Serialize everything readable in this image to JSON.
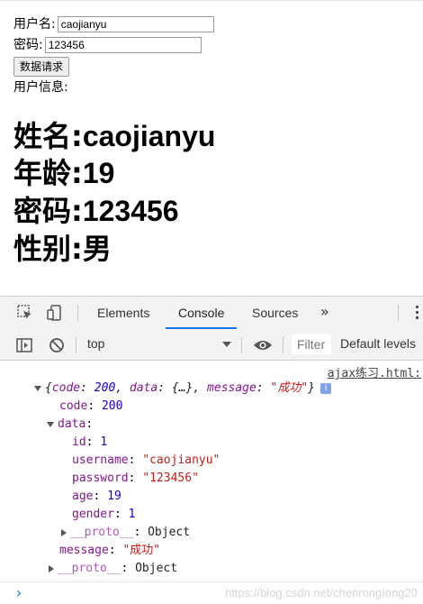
{
  "form": {
    "username_label": "用户名:",
    "username_value": "caojianyu",
    "password_label": "密码:",
    "password_value": "123456",
    "request_button": "数据请求",
    "info_label": "用户信息:"
  },
  "user_info": [
    {
      "label": "姓名:",
      "value": "caojianyu"
    },
    {
      "label": "年龄:",
      "value": "19"
    },
    {
      "label": "密码:",
      "value": "123456"
    },
    {
      "label": "性别:",
      "value": "男"
    }
  ],
  "devtools": {
    "tabs": [
      "Elements",
      "Console",
      "Sources"
    ],
    "active_tab": "Console",
    "more_tabs": "»",
    "context": "top",
    "filter_placeholder": "Filter",
    "levels": "Default levels",
    "icons": [
      "inspect-icon",
      "device-toolbar-icon",
      "sidebar-toggle-icon",
      "clear-console-icon",
      "eye-icon",
      "kebab-menu-icon"
    ]
  },
  "console": {
    "source_link": "ajax练习.html:",
    "summary": {
      "open": "{",
      "code_key": "code",
      "code_val": "200",
      "data_key": "data",
      "data_preview": "{…}",
      "message_key": "message",
      "message_val": "\"成功\"",
      "close": "}",
      "info_badge": "i"
    },
    "code_line": {
      "key": "code",
      "value": "200"
    },
    "data_line": {
      "key": "data"
    },
    "data_fields": [
      {
        "key": "id",
        "value": "1",
        "kind": "num"
      },
      {
        "key": "username",
        "value": "\"caojianyu\"",
        "kind": "str"
      },
      {
        "key": "password",
        "value": "\"123456\"",
        "kind": "str"
      },
      {
        "key": "age",
        "value": "19",
        "kind": "num"
      },
      {
        "key": "gender",
        "value": "1",
        "kind": "num"
      }
    ],
    "inner_proto": {
      "key": "__proto__",
      "value": "Object"
    },
    "message_line": {
      "key": "message",
      "value": "\"成功\""
    },
    "outer_proto": {
      "key": "__proto__",
      "value": "Object"
    },
    "prompt": "›",
    "watermark": "https://blog.csdn.net/chenrongIong20"
  },
  "colors": {
    "accent": "#1a73e8",
    "key": "#881391",
    "number": "#1c00cf",
    "string": "#c41a16"
  }
}
